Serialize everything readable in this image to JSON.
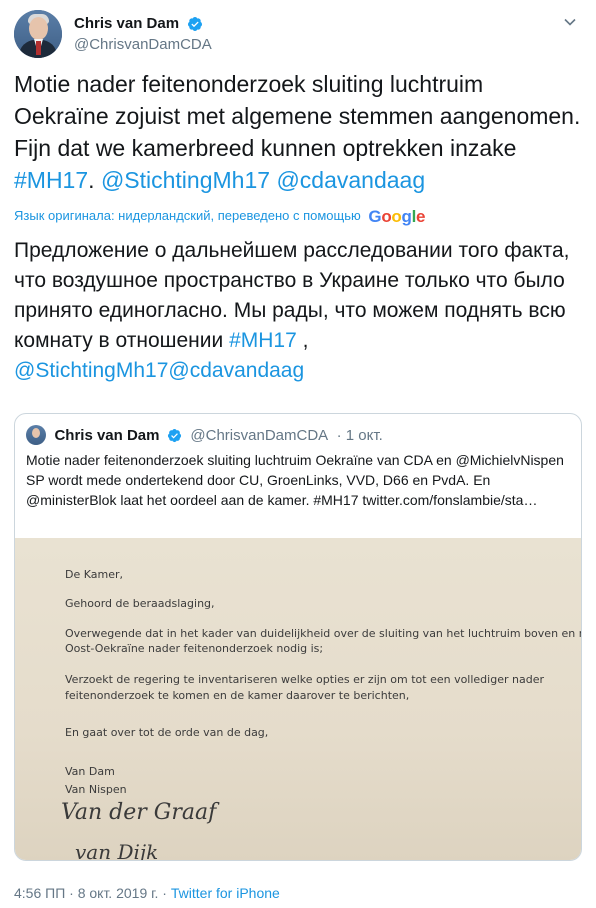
{
  "author": {
    "display_name": "Chris van Dam",
    "handle": "@ChrisvanDamCDA"
  },
  "tweet": {
    "text_plain": "Motie nader feitenonderzoek sluiting luchtruim Oekraïne zojuist met algemene stemmen aangenomen. Fijn dat we kamerbreed kunnen optrekken inzake ",
    "hashtag": "#MH17",
    "separator": ". ",
    "mention_1": "@StichtingMh17",
    "mention_2": "@cdavandaag"
  },
  "translation": {
    "note": "Язык оригинала: нидерландский, переведено с помощью",
    "provider": "Google",
    "text_plain": "Предложение о дальнейшем расследовании того факта, что воздушное пространство в Украине только что было принято единогласно. Мы рады, что можем поднять всю комнату в отношении ",
    "hashtag": "#MH17",
    "comma": " ,",
    "mention_1": "@StichtingMh17",
    "mention_2": "@cdavandaag"
  },
  "quoted_tweet": {
    "display_name": "Chris van Dam",
    "handle": "@ChrisvanDamCDA",
    "date": "· 1 окт.",
    "text": "Motie nader feitenonderzoek sluiting luchtruim Oekraïne van CDA en @MichielvNispen SP wordt mede ondertekend door CU, GroenLinks, VVD, D66 en PvdA. En @ministerBlok laat het oordeel aan de kamer. #MH17 twitter.com/fonslambie/sta…",
    "document_lines": [
      "De Kamer,",
      "Gehoord de beraadslaging,",
      "Overwegende dat in het kader van duidelijkheid over de sluiting van het luchtruim boven en rond",
      "Oost-Oekraïne nader feitenonderzoek nodig is;",
      "Verzoekt de regering te inventariseren welke opties er zijn om tot een vollediger nader",
      "feitenonderzoek te komen en de kamer daarover te berichten,",
      "En gaat over tot de orde van de dag,",
      "Van Dam",
      "Van Nispen"
    ],
    "signatures": [
      "Van der Graaf",
      "van Dijk"
    ]
  },
  "meta": {
    "time": "4:56 ПП · 8 окт. 2019 г.",
    "separator": " · ",
    "source": "Twitter for iPhone"
  },
  "colors": {
    "link": "#1b95e0",
    "secondary": "#657786",
    "border": "#ccd6dd",
    "verified": "#1da1f2"
  },
  "icons": {
    "verified": "verified-badge-icon",
    "more": "chevron-down-icon"
  }
}
